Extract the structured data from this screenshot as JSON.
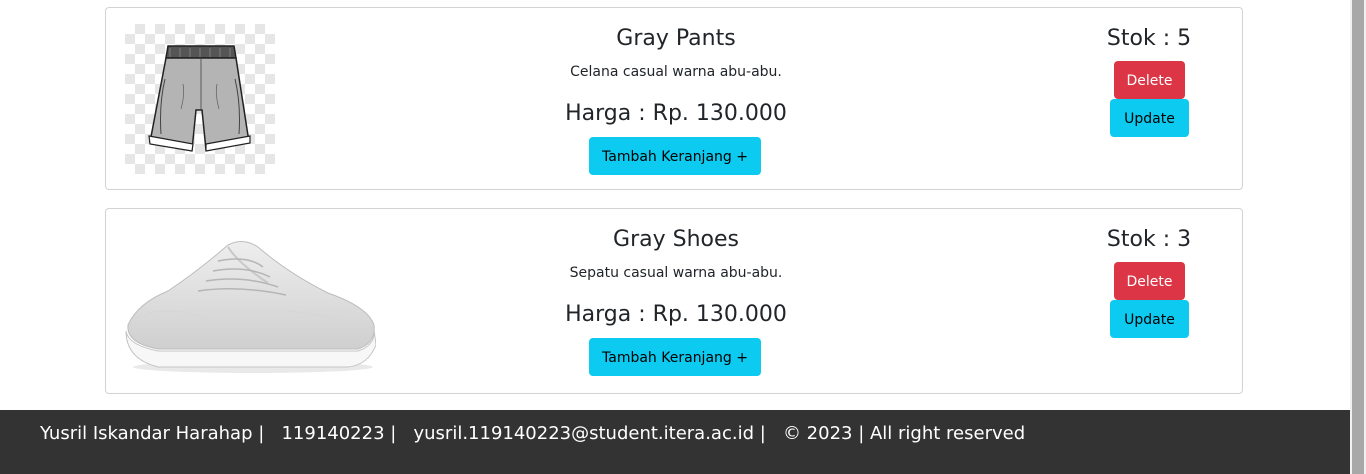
{
  "products": [
    {
      "name": "Gray Pants",
      "description": "Celana casual warna abu-abu.",
      "price": "Harga : Rp. 130.000",
      "stock": "Stok : 5",
      "cart_label": "Tambah Keranjang +",
      "delete_label": "Delete",
      "update_label": "Update",
      "image_icon": "pants-image"
    },
    {
      "name": "Gray Shoes",
      "description": "Sepatu casual warna abu-abu.",
      "price": "Harga : Rp. 130.000",
      "stock": "Stok : 3",
      "cart_label": "Tambah Keranjang +",
      "delete_label": "Delete",
      "update_label": "Update",
      "image_icon": "shoe-image"
    }
  ],
  "footer": {
    "text": "Yusril Iskandar Harahap |   119140223 |   yusril.119140223@student.itera.ac.id |   © 2023 | All right reserved"
  },
  "colors": {
    "danger": "#dc3545",
    "info": "#0dcaf0",
    "footer_bg": "#333333"
  }
}
